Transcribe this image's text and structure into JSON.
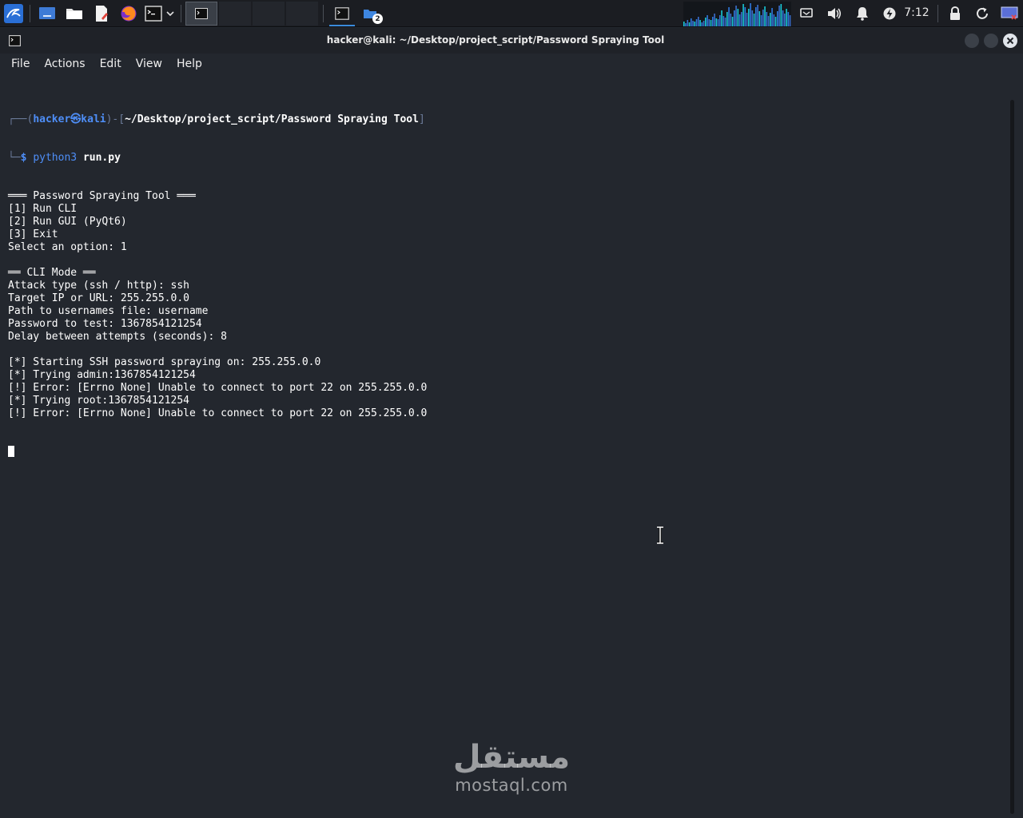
{
  "panel": {
    "clock": "7:12",
    "workspace_badge": "2"
  },
  "window": {
    "title": "hacker@kali: ~/Desktop/project_script/Password Spraying Tool"
  },
  "menu": [
    "File",
    "Actions",
    "Edit",
    "View",
    "Help"
  ],
  "prompt": {
    "user": "hacker",
    "at": "㉿",
    "host": "kali",
    "path": "~/Desktop/project_script/Password Spraying Tool",
    "dollar": "$",
    "command": "python3",
    "argument": "run.py"
  },
  "output_lines": [
    "═══ Password Spraying Tool ═══",
    "[1] Run CLI",
    "[2] Run GUI (PyQt6)",
    "[3] Exit",
    "Select an option: 1",
    "",
    "══ CLI Mode ══",
    "Attack type (ssh / http): ssh",
    "Target IP or URL: 255.255.0.0",
    "Path to usernames file: username",
    "Password to test: 1367854121254",
    "Delay between attempts (seconds): 8",
    "",
    "[*] Starting SSH password spraying on: 255.255.0.0",
    "[*] Trying admin:1367854121254",
    "[!] Error: [Errno None] Unable to connect to port 22 on 255.255.0.0",
    "[*] Trying root:1367854121254",
    "[!] Error: [Errno None] Unable to connect to port 22 on 255.255.0.0"
  ],
  "watermark": {
    "arabic": "مستقل",
    "latin": "mostaql.com"
  },
  "colors": {
    "accent": "#4e8ef7",
    "terminal_bg": "#23272e",
    "panel_bg": "#1b1d22"
  }
}
